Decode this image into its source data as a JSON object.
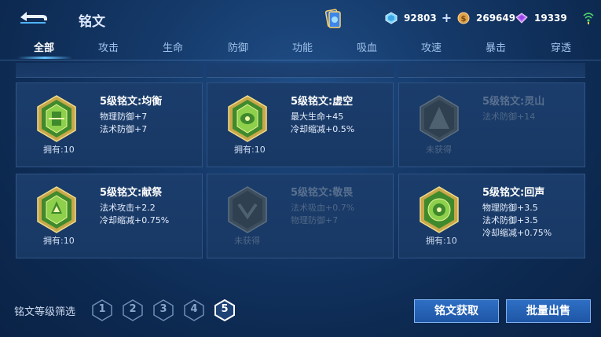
{
  "header": {
    "title": "铭文",
    "resources": [
      {
        "icon": "diamond-icon",
        "value": "92803",
        "color": "#7fd6ff",
        "has_plus": true
      },
      {
        "icon": "gold-coin-icon",
        "value": "269649",
        "color": "#e0a34b",
        "has_plus": false
      },
      {
        "icon": "crystal-icon",
        "value": "19339",
        "color": "#c57bff",
        "has_plus": false
      }
    ],
    "plus_glyph": "+"
  },
  "tabs": [
    "全部",
    "攻击",
    "生命",
    "防御",
    "功能",
    "吸血",
    "攻速",
    "暴击",
    "穿透"
  ],
  "active_tab": "全部",
  "cards": [
    {
      "name": "5级铭文:均衡",
      "attrs": [
        "物理防御+7",
        "法术防御+7"
      ],
      "own": "拥有:10",
      "obtained": true
    },
    {
      "name": "5级铭文:虚空",
      "attrs": [
        "最大生命+45",
        "冷却缩减+0.5%"
      ],
      "own": "拥有:10",
      "obtained": true
    },
    {
      "name": "5级铭文:灵山",
      "attrs": [
        "法术防御+14"
      ],
      "own": "未获得",
      "obtained": false
    },
    {
      "name": "5级铭文:献祭",
      "attrs": [
        "法术攻击+2.2",
        "冷却缩减+0.75%"
      ],
      "own": "拥有:10",
      "obtained": true
    },
    {
      "name": "5级铭文:敬畏",
      "attrs": [
        "法术吸血+0.7%",
        "物理防御+7"
      ],
      "own": "未获得",
      "obtained": false
    },
    {
      "name": "5级铭文:回声",
      "attrs": [
        "物理防御+3.5",
        "法术防御+3.5",
        "冷却缩减+0.75%"
      ],
      "own": "拥有:10",
      "obtained": true
    }
  ],
  "filter": {
    "label": "铭文等级筛选",
    "levels": [
      "1",
      "2",
      "3",
      "4",
      "5"
    ],
    "selected": "5"
  },
  "buttons": {
    "acquire": "铭文获取",
    "bulk_sell": "批量出售"
  }
}
